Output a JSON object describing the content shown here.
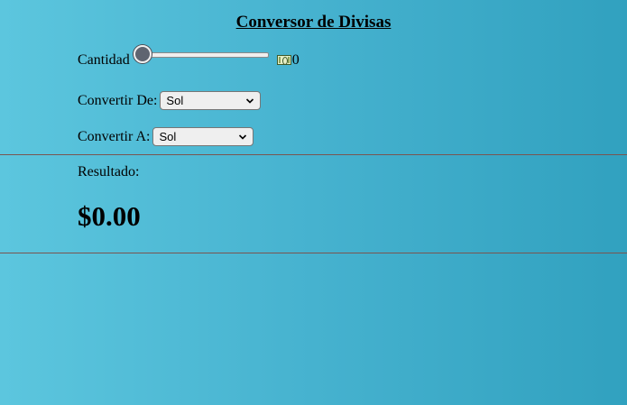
{
  "page": {
    "title": "Conversor de Divisas"
  },
  "amount": {
    "label": "Cantidad",
    "slider_fraction": 0,
    "value": "0",
    "icon": "money-icon"
  },
  "from": {
    "label": "Convertir De:",
    "selected": "Sol"
  },
  "to": {
    "label": "Convertir A:",
    "selected": "Sol"
  },
  "result": {
    "label": "Resultado:",
    "value": "$0.00"
  },
  "colors": {
    "background_start": "#5cc6de",
    "background_end": "#31a1bf",
    "divider": "#7a5550",
    "slider_thumb": "#5f6470"
  }
}
